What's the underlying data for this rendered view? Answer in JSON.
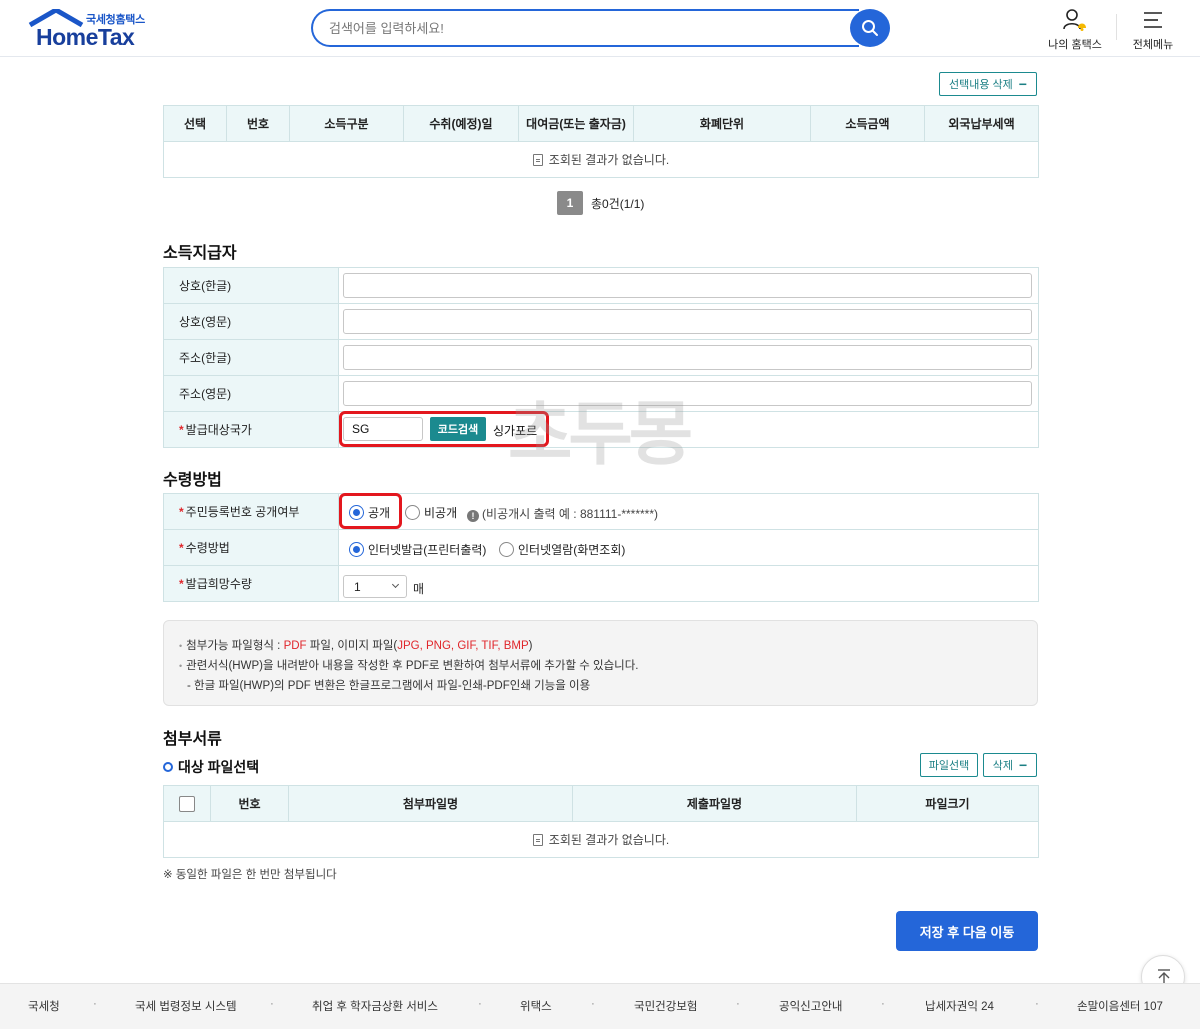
{
  "header": {
    "logo_sub": "국세청홈택스",
    "logo_main": "HomeTax",
    "search_placeholder": "검색어를 입력하세요!",
    "my_hometax": "나의 홈택스",
    "all_menu": "전체메뉴"
  },
  "list": {
    "delete_selected": "선택내용 삭제",
    "columns": [
      "선택",
      "번호",
      "소득구분",
      "수취(예정)일",
      "대여금(또는 출자금)",
      "화폐단위",
      "소득금액",
      "외국납부세액"
    ],
    "empty_message": "조회된 결과가 없습니다.",
    "page": "1",
    "total": "총0건(1/1)"
  },
  "payer": {
    "title": "소득지급자",
    "rows": [
      {
        "label": "상호(한글)",
        "value": ""
      },
      {
        "label": "상호(영문)",
        "value": ""
      },
      {
        "label": "주소(한글)",
        "value": ""
      },
      {
        "label": "주소(영문)",
        "value": ""
      }
    ],
    "country_label": "발급대상국가",
    "country_code": "SG",
    "code_search": "코드검색",
    "country_name": "싱가포르"
  },
  "receive": {
    "title": "수령방법",
    "ssn_label": "주민등록번호 공개여부",
    "ssn_public": "공개",
    "ssn_private": "비공개",
    "ssn_info": "(비공개시 출력 예 : 881111-*******)",
    "method_label": "수령방법",
    "method_internet_print": "인터넷발급(프린터출력)",
    "method_internet_view": "인터넷열람(화면조회)",
    "qty_label": "발급희망수량",
    "qty_value": "1",
    "qty_unit": "매"
  },
  "notice": {
    "line1_a": "첨부가능 파일형식 : ",
    "line1_pdf": "PDF",
    "line1_b": " 파일, 이미지 파일(",
    "line1_img": "JPG, PNG, GIF, TIF, BMP",
    "line1_c": ")",
    "line2": "관련서식(HWP)을 내려받아 내용을 작성한 후 PDF로 변환하여 첨부서류에 추가할 수 있습니다.",
    "line3": "- 한글 파일(HWP)의 PDF 변환은 한글프로그램에서 파일-인쇄-PDF인쇄 기능을 이용"
  },
  "attach": {
    "title": "첨부서류",
    "subtitle": "대상 파일선택",
    "file_select": "파일선택",
    "delete": "삭제",
    "columns": [
      "번호",
      "첨부파일명",
      "제출파일명",
      "파일크기"
    ],
    "empty_message": "조회된 결과가 없습니다.",
    "footnote": "※ 동일한 파일은 한 번만 첨부됩니다"
  },
  "actions": {
    "save_next": "저장 후 다음 이동"
  },
  "watermark": "초두몽",
  "footer": {
    "links": [
      "국세청",
      "국세 법령정보 시스템",
      "취업 후 학자금상환 서비스",
      "위택스",
      "국민건강보험",
      "공익신고안내",
      "납세자권익 24",
      "손말이음센터 107"
    ],
    "separator": "·"
  },
  "colors": {
    "primary": "#2466d9",
    "teal": "#1b8a8f",
    "highlight": "#e3171e",
    "table_header": "#ecf7f8"
  }
}
